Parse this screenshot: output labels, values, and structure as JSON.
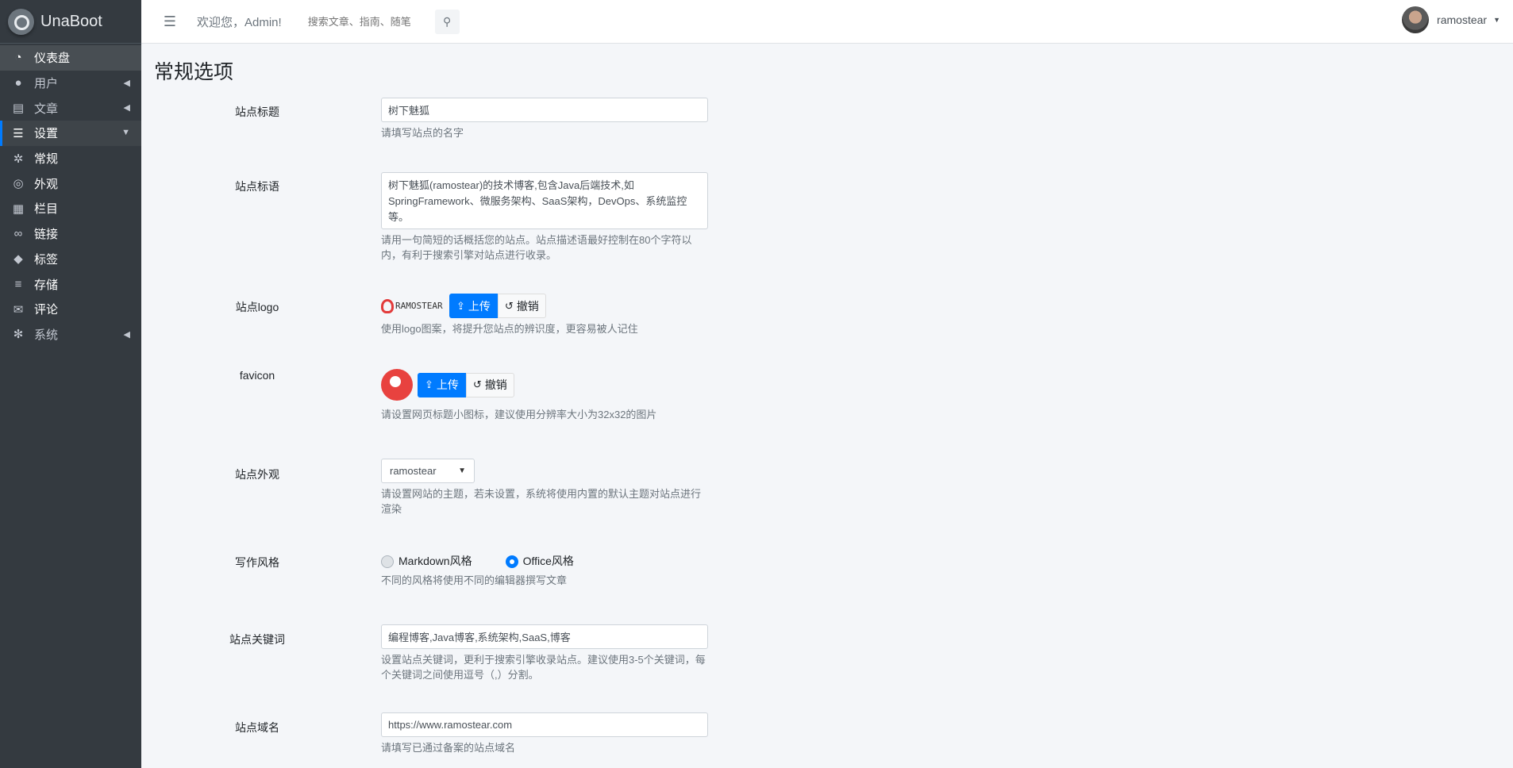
{
  "brand": {
    "name": "UnaBoot"
  },
  "sidebar": {
    "items": [
      {
        "label": "仪表盘",
        "icon": "dashboard-icon"
      },
      {
        "label": "用户",
        "icon": "users-icon"
      },
      {
        "label": "文章",
        "icon": "document-icon"
      },
      {
        "label": "设置",
        "icon": "sliders-icon"
      },
      {
        "label": "常规",
        "icon": "gear-icon"
      },
      {
        "label": "外观",
        "icon": "chrome-icon"
      },
      {
        "label": "栏目",
        "icon": "grid-icon"
      },
      {
        "label": "链接",
        "icon": "link-icon"
      },
      {
        "label": "标签",
        "icon": "tags-icon"
      },
      {
        "label": "存储",
        "icon": "server-icon"
      },
      {
        "label": "评论",
        "icon": "comments-icon"
      },
      {
        "label": "系统",
        "icon": "cogs-icon"
      }
    ]
  },
  "topbar": {
    "welcome": "欢迎您，Admin!",
    "search_placeholder": "搜索文章、指南、随笔",
    "username": "ramostear"
  },
  "page": {
    "title": "常规选项",
    "site_title": {
      "label": "站点标题",
      "value": "树下魅狐",
      "help": "请填写站点的名字"
    },
    "site_slogan": {
      "label": "站点标语",
      "value": "树下魅狐(ramostear)的技术博客,包含Java后端技术,如SpringFramework、微服务架构、SaaS架构，DevOps、系统监控等。",
      "help": "请用一句简短的话概括您的站点。站点描述语最好控制在80个字符以内，有利于搜索引擎对站点进行收录。"
    },
    "site_logo": {
      "label": "站点logo",
      "logo_text": "RAMOSTEAR",
      "upload": "上传",
      "undo": "撤销",
      "help": "使用logo图案，将提升您站点的辨识度，更容易被人记住"
    },
    "favicon": {
      "label": "favicon",
      "upload": "上传",
      "undo": "撤销",
      "help": "请设置网页标题小图标，建议使用分辨率大小为32x32的图片"
    },
    "theme": {
      "label": "站点外观",
      "value": "ramostear",
      "help": "请设置网站的主题，若未设置，系统将使用内置的默认主题对站点进行渲染"
    },
    "writing_style": {
      "label": "写作风格",
      "option_markdown": "Markdown风格",
      "option_office": "Office风格",
      "selected": "Office风格",
      "help": "不同的风格将使用不同的编辑器撰写文章"
    },
    "keywords": {
      "label": "站点关键词",
      "value": "编程博客,Java博客,系统架构,SaaS,博客",
      "help": "设置站点关键词，更利于搜索引擎收录站点。建议使用3-5个关键词，每个关键词之间使用逗号（,）分割。"
    },
    "domain": {
      "label": "站点域名",
      "value": "https://www.ramostear.com",
      "help": "请填写已通过备案的站点域名"
    }
  },
  "colors": {
    "sidebar_bg": "#343a40",
    "primary": "#007bff",
    "content_bg": "#f4f6f9"
  }
}
